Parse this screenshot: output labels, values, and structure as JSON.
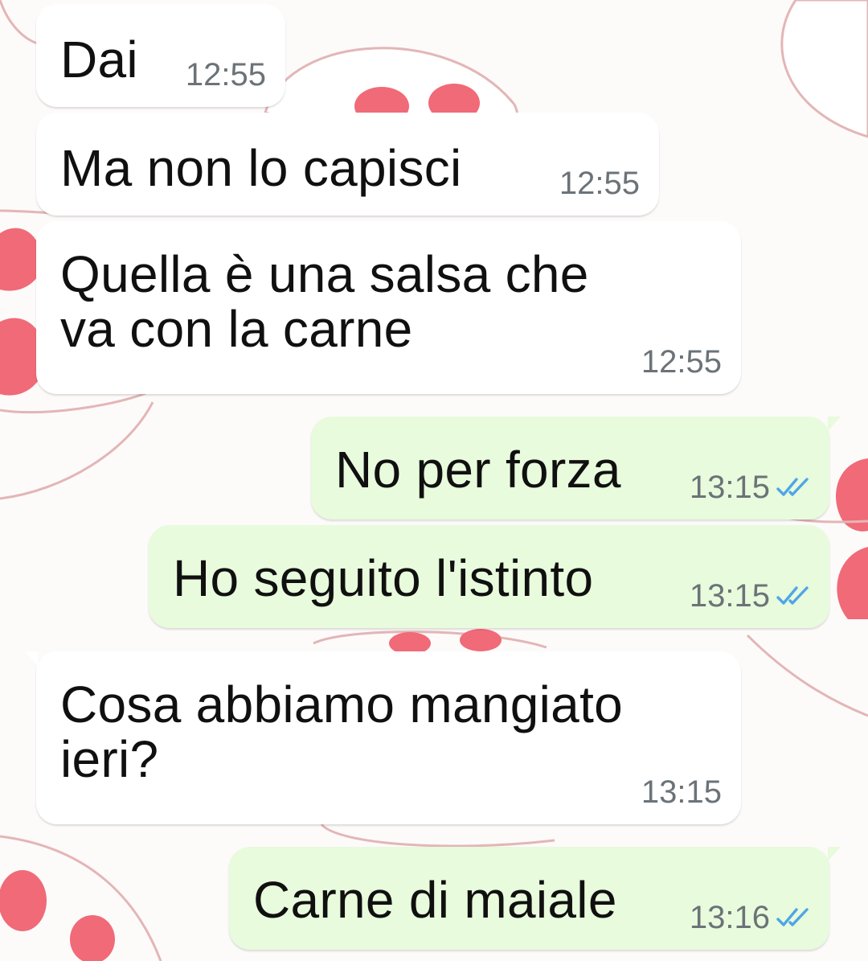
{
  "conversation": {
    "messages": [
      {
        "direction": "incoming",
        "text": "Dai",
        "time": "12:55"
      },
      {
        "direction": "incoming",
        "text": "Ma non lo capisci",
        "time": "12:55"
      },
      {
        "direction": "incoming",
        "text_lines": [
          "Quella è una salsa che",
          "va con la carne"
        ],
        "time": "12:55"
      },
      {
        "direction": "outgoing",
        "text": "No per forza",
        "time": "13:15",
        "status": "read",
        "status_icon": "double-check-icon"
      },
      {
        "direction": "outgoing",
        "text": "Ho seguito l'istinto",
        "time": "13:15",
        "status": "read",
        "status_icon": "double-check-icon"
      },
      {
        "direction": "incoming",
        "text_lines": [
          "Cosa abbiamo mangiato",
          "ieri?"
        ],
        "time": "13:15"
      },
      {
        "direction": "outgoing",
        "text": "Carne di maiale",
        "time": "13:16",
        "status": "read",
        "status_icon": "double-check-icon"
      }
    ]
  },
  "colors": {
    "incoming_bubble": "#ffffff",
    "outgoing_bubble": "#e8fbdc",
    "read_ticks": "#4fa6e6",
    "timestamp": "#6b7378",
    "wallpaper_paw_pad": "#f06a78"
  },
  "wallpaper": {
    "pattern": "cat-paw"
  }
}
